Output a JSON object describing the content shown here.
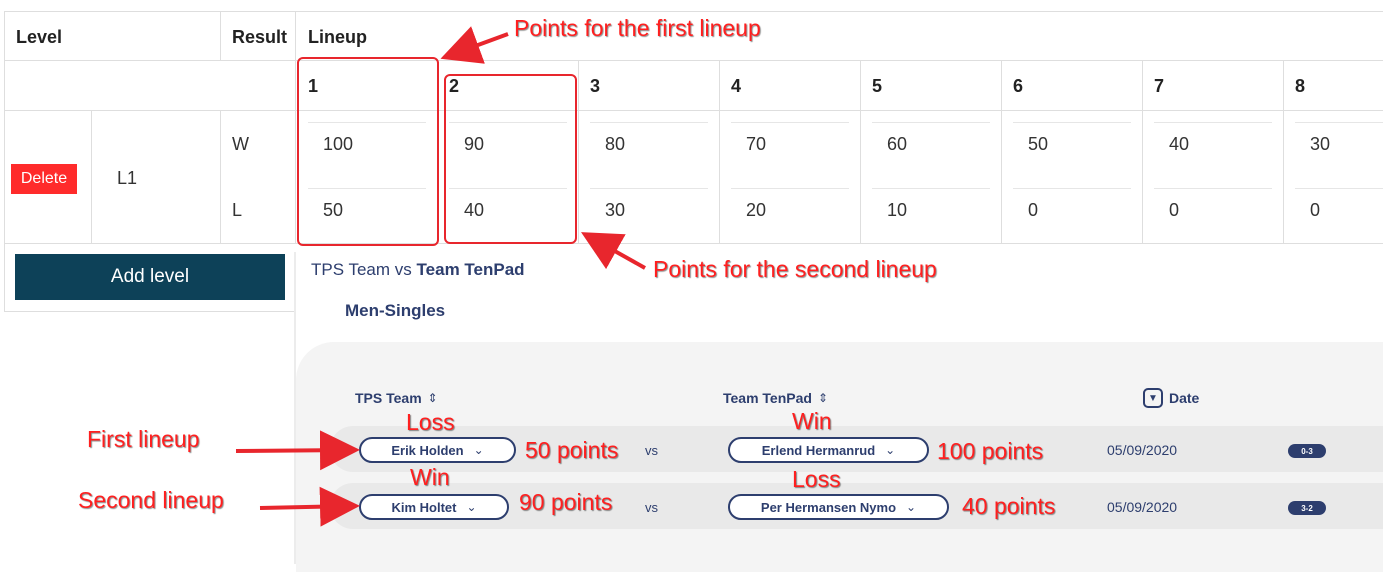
{
  "table": {
    "headers": {
      "level": "Level",
      "result": "Result",
      "lineup": "Lineup"
    },
    "lineup_numbers": [
      "1",
      "2",
      "3",
      "4",
      "5",
      "6",
      "7",
      "8"
    ],
    "delete_label": "Delete",
    "level_name": "L1",
    "win_label": "W",
    "loss_label": "L",
    "win_points": [
      "100",
      "90",
      "80",
      "70",
      "60",
      "50",
      "40",
      "30"
    ],
    "loss_points": [
      "50",
      "40",
      "30",
      "20",
      "10",
      "0",
      "0",
      "0"
    ],
    "add_level_label": "Add level"
  },
  "match": {
    "home_team": "TPS Team",
    "vs_word": "vs",
    "away_team": "Team TenPad",
    "group": "Men-Singles",
    "col_home": "TPS Team",
    "col_away": "Team TenPad",
    "col_date": "Date",
    "rows": [
      {
        "home_player": "Erik Holden",
        "vs": "vs",
        "away_player": "Erlend Hermanrud",
        "date": "05/09/2020",
        "score": "0-3"
      },
      {
        "home_player": "Kim Holtet",
        "vs": "vs",
        "away_player": "Per Hermansen Nymo",
        "date": "05/09/2020",
        "score": "3-2"
      }
    ]
  },
  "annotations": {
    "first_lineup_points": "Points for the first lineup",
    "second_lineup_points": "Points for the second lineup",
    "first_lineup": "First lineup",
    "second_lineup": "Second lineup",
    "row1_home_result": "Loss",
    "row1_home_points": "50 points",
    "row1_away_result": "Win",
    "row1_away_points": "100 points",
    "row2_home_result": "Win",
    "row2_home_points": "90 points",
    "row2_away_result": "Loss",
    "row2_away_points": "40 points"
  },
  "colors": {
    "delete": "#ff2b2b",
    "add_level": "#0d4158",
    "navy": "#2d3e6e",
    "annotation": "#ff1f1f"
  }
}
